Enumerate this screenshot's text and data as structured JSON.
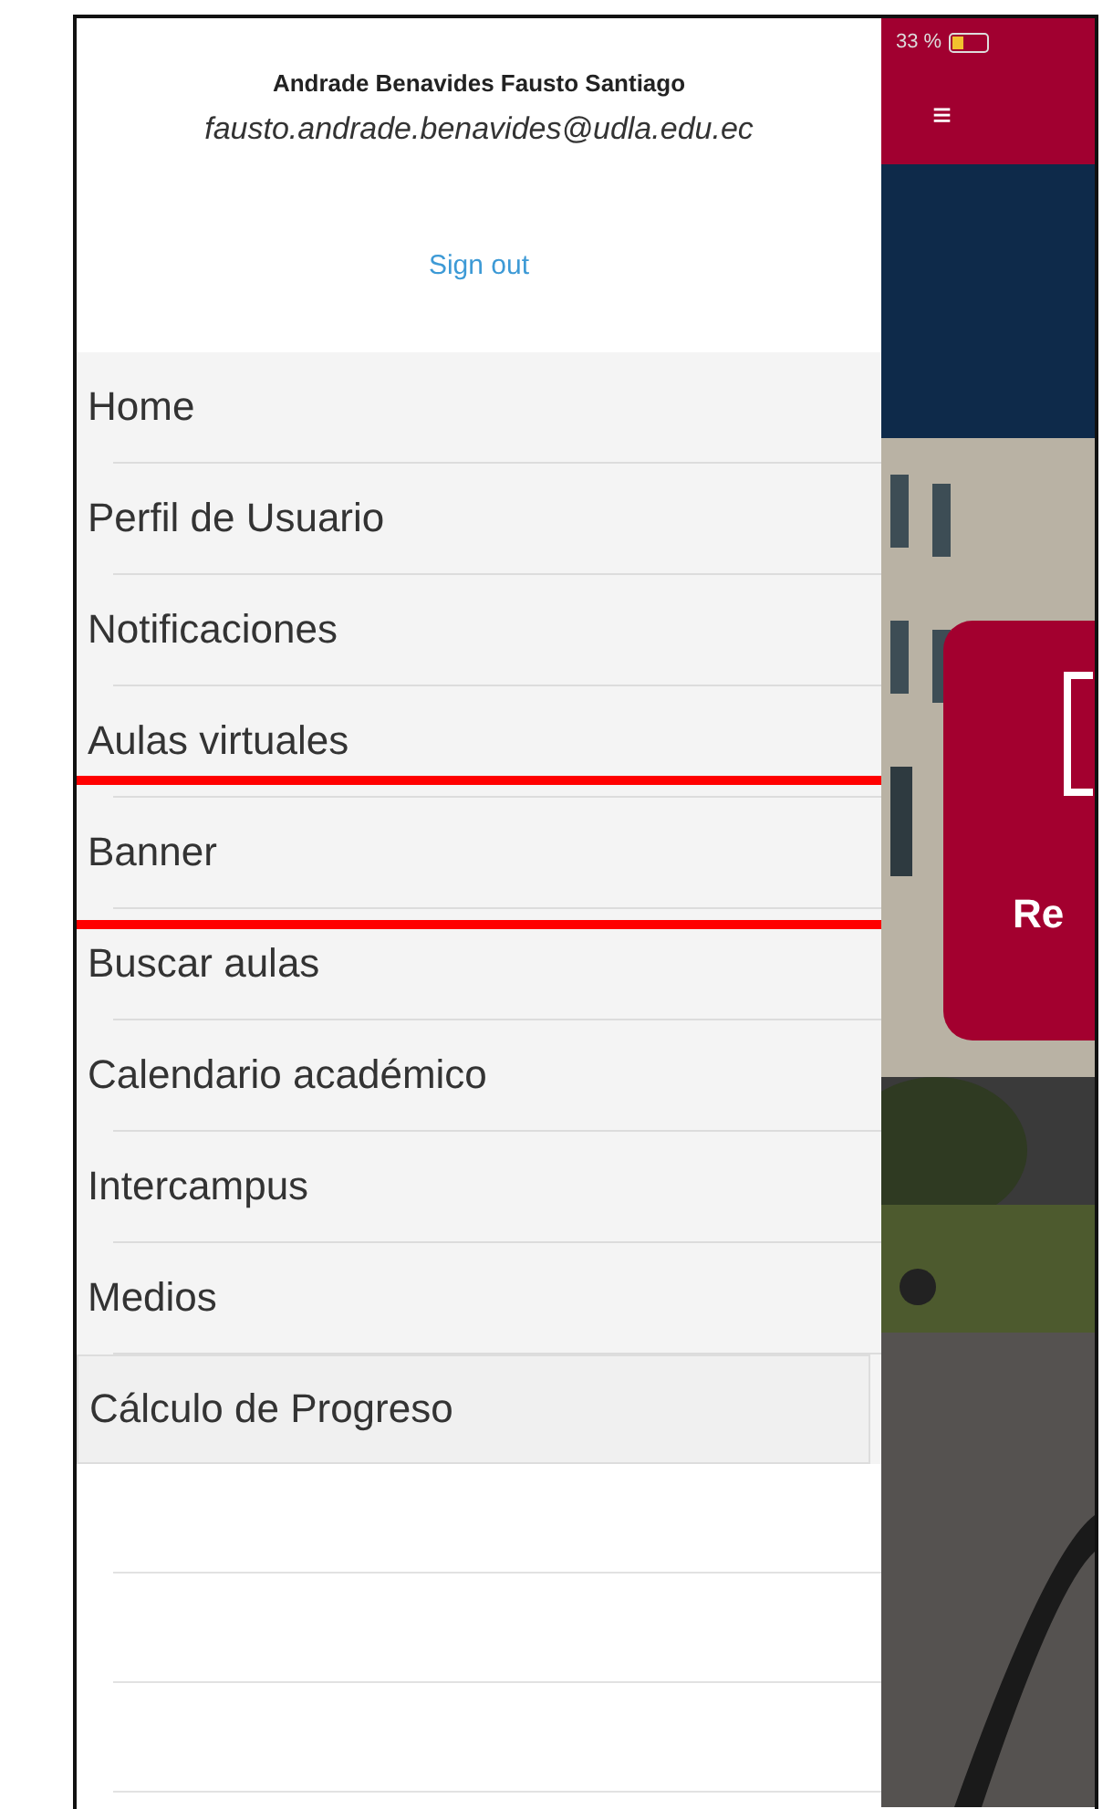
{
  "drawer": {
    "user_name": "Andrade Benavides Fausto Santiago",
    "email": "fausto.andrade.benavides@udla.edu.ec",
    "sign_out": "Sign out",
    "items": [
      {
        "label": "Home",
        "highlighted": false
      },
      {
        "label": "Perfil de Usuario",
        "highlighted": false
      },
      {
        "label": "Notificaciones",
        "highlighted": false
      },
      {
        "label": "Aulas virtuales",
        "highlighted": false
      },
      {
        "label": "Banner",
        "highlighted": true
      },
      {
        "label": "Buscar aulas",
        "highlighted": false
      },
      {
        "label": "Calendario académico",
        "highlighted": false
      },
      {
        "label": "Intercampus",
        "highlighted": false
      },
      {
        "label": "Medios",
        "highlighted": false
      },
      {
        "label": "Cálculo de Progreso",
        "highlighted": false
      }
    ]
  },
  "background_app": {
    "battery_text": "33 %",
    "menu_glyph": "≡",
    "card_text": "Re"
  }
}
